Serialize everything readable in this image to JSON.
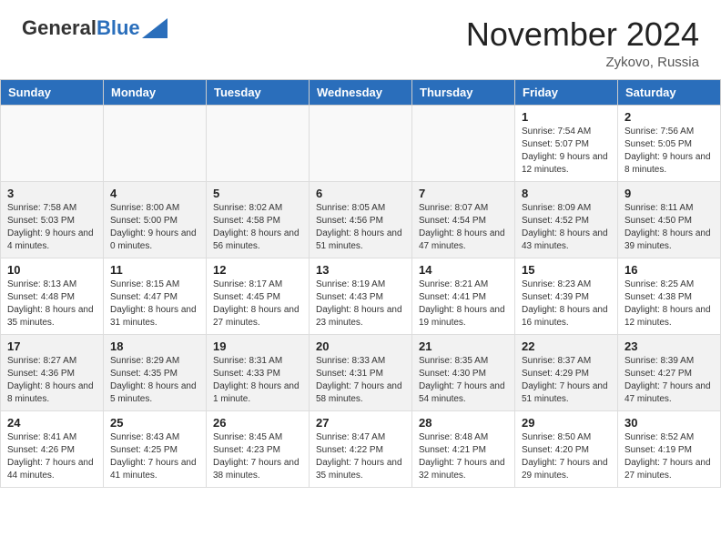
{
  "header": {
    "logo_general": "General",
    "logo_blue": "Blue",
    "month_title": "November 2024",
    "location": "Zykovo, Russia"
  },
  "days_of_week": [
    "Sunday",
    "Monday",
    "Tuesday",
    "Wednesday",
    "Thursday",
    "Friday",
    "Saturday"
  ],
  "weeks": [
    {
      "shaded": false,
      "days": [
        {
          "number": "",
          "info": "",
          "empty": true
        },
        {
          "number": "",
          "info": "",
          "empty": true
        },
        {
          "number": "",
          "info": "",
          "empty": true
        },
        {
          "number": "",
          "info": "",
          "empty": true
        },
        {
          "number": "",
          "info": "",
          "empty": true
        },
        {
          "number": "1",
          "info": "Sunrise: 7:54 AM\nSunset: 5:07 PM\nDaylight: 9 hours and 12 minutes.",
          "empty": false
        },
        {
          "number": "2",
          "info": "Sunrise: 7:56 AM\nSunset: 5:05 PM\nDaylight: 9 hours and 8 minutes.",
          "empty": false
        }
      ]
    },
    {
      "shaded": true,
      "days": [
        {
          "number": "3",
          "info": "Sunrise: 7:58 AM\nSunset: 5:03 PM\nDaylight: 9 hours and 4 minutes.",
          "empty": false
        },
        {
          "number": "4",
          "info": "Sunrise: 8:00 AM\nSunset: 5:00 PM\nDaylight: 9 hours and 0 minutes.",
          "empty": false
        },
        {
          "number": "5",
          "info": "Sunrise: 8:02 AM\nSunset: 4:58 PM\nDaylight: 8 hours and 56 minutes.",
          "empty": false
        },
        {
          "number": "6",
          "info": "Sunrise: 8:05 AM\nSunset: 4:56 PM\nDaylight: 8 hours and 51 minutes.",
          "empty": false
        },
        {
          "number": "7",
          "info": "Sunrise: 8:07 AM\nSunset: 4:54 PM\nDaylight: 8 hours and 47 minutes.",
          "empty": false
        },
        {
          "number": "8",
          "info": "Sunrise: 8:09 AM\nSunset: 4:52 PM\nDaylight: 8 hours and 43 minutes.",
          "empty": false
        },
        {
          "number": "9",
          "info": "Sunrise: 8:11 AM\nSunset: 4:50 PM\nDaylight: 8 hours and 39 minutes.",
          "empty": false
        }
      ]
    },
    {
      "shaded": false,
      "days": [
        {
          "number": "10",
          "info": "Sunrise: 8:13 AM\nSunset: 4:48 PM\nDaylight: 8 hours and 35 minutes.",
          "empty": false
        },
        {
          "number": "11",
          "info": "Sunrise: 8:15 AM\nSunset: 4:47 PM\nDaylight: 8 hours and 31 minutes.",
          "empty": false
        },
        {
          "number": "12",
          "info": "Sunrise: 8:17 AM\nSunset: 4:45 PM\nDaylight: 8 hours and 27 minutes.",
          "empty": false
        },
        {
          "number": "13",
          "info": "Sunrise: 8:19 AM\nSunset: 4:43 PM\nDaylight: 8 hours and 23 minutes.",
          "empty": false
        },
        {
          "number": "14",
          "info": "Sunrise: 8:21 AM\nSunset: 4:41 PM\nDaylight: 8 hours and 19 minutes.",
          "empty": false
        },
        {
          "number": "15",
          "info": "Sunrise: 8:23 AM\nSunset: 4:39 PM\nDaylight: 8 hours and 16 minutes.",
          "empty": false
        },
        {
          "number": "16",
          "info": "Sunrise: 8:25 AM\nSunset: 4:38 PM\nDaylight: 8 hours and 12 minutes.",
          "empty": false
        }
      ]
    },
    {
      "shaded": true,
      "days": [
        {
          "number": "17",
          "info": "Sunrise: 8:27 AM\nSunset: 4:36 PM\nDaylight: 8 hours and 8 minutes.",
          "empty": false
        },
        {
          "number": "18",
          "info": "Sunrise: 8:29 AM\nSunset: 4:35 PM\nDaylight: 8 hours and 5 minutes.",
          "empty": false
        },
        {
          "number": "19",
          "info": "Sunrise: 8:31 AM\nSunset: 4:33 PM\nDaylight: 8 hours and 1 minute.",
          "empty": false
        },
        {
          "number": "20",
          "info": "Sunrise: 8:33 AM\nSunset: 4:31 PM\nDaylight: 7 hours and 58 minutes.",
          "empty": false
        },
        {
          "number": "21",
          "info": "Sunrise: 8:35 AM\nSunset: 4:30 PM\nDaylight: 7 hours and 54 minutes.",
          "empty": false
        },
        {
          "number": "22",
          "info": "Sunrise: 8:37 AM\nSunset: 4:29 PM\nDaylight: 7 hours and 51 minutes.",
          "empty": false
        },
        {
          "number": "23",
          "info": "Sunrise: 8:39 AM\nSunset: 4:27 PM\nDaylight: 7 hours and 47 minutes.",
          "empty": false
        }
      ]
    },
    {
      "shaded": false,
      "days": [
        {
          "number": "24",
          "info": "Sunrise: 8:41 AM\nSunset: 4:26 PM\nDaylight: 7 hours and 44 minutes.",
          "empty": false
        },
        {
          "number": "25",
          "info": "Sunrise: 8:43 AM\nSunset: 4:25 PM\nDaylight: 7 hours and 41 minutes.",
          "empty": false
        },
        {
          "number": "26",
          "info": "Sunrise: 8:45 AM\nSunset: 4:23 PM\nDaylight: 7 hours and 38 minutes.",
          "empty": false
        },
        {
          "number": "27",
          "info": "Sunrise: 8:47 AM\nSunset: 4:22 PM\nDaylight: 7 hours and 35 minutes.",
          "empty": false
        },
        {
          "number": "28",
          "info": "Sunrise: 8:48 AM\nSunset: 4:21 PM\nDaylight: 7 hours and 32 minutes.",
          "empty": false
        },
        {
          "number": "29",
          "info": "Sunrise: 8:50 AM\nSunset: 4:20 PM\nDaylight: 7 hours and 29 minutes.",
          "empty": false
        },
        {
          "number": "30",
          "info": "Sunrise: 8:52 AM\nSunset: 4:19 PM\nDaylight: 7 hours and 27 minutes.",
          "empty": false
        }
      ]
    }
  ]
}
